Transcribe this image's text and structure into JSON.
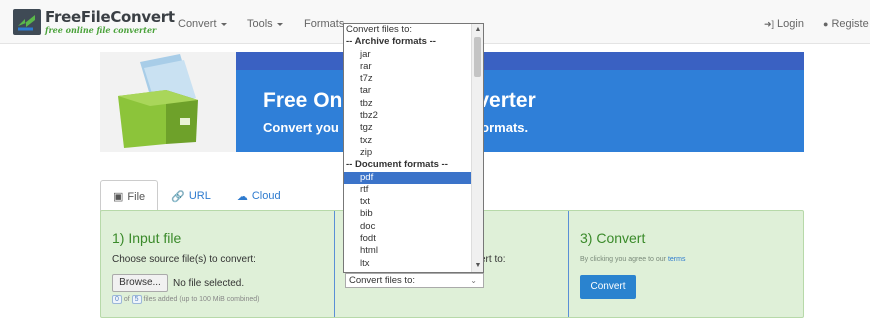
{
  "brand": {
    "name": "FreeFileConvert",
    "tagline": "free online file converter"
  },
  "nav": {
    "items": [
      {
        "label": "Convert",
        "caret": true
      },
      {
        "label": "Tools",
        "caret": true
      },
      {
        "label": "Formats",
        "caret": false
      }
    ],
    "login": "Login",
    "register": "Registe"
  },
  "banner": {
    "title_a": "Free On",
    "title_b": "verter",
    "sub_a": "Convert you",
    "sub_b": "formats."
  },
  "tabs": [
    {
      "label": "File",
      "icon": "monitor-icon",
      "active": true
    },
    {
      "label": "URL",
      "icon": "link-icon",
      "active": false
    },
    {
      "label": "Cloud",
      "icon": "cloud-icon",
      "active": false
    }
  ],
  "input_col": {
    "heading": "1) Input file",
    "label": "Choose source file(s) to convert:",
    "browse": "Browse...",
    "no_file": "No file selected.",
    "count": "0",
    "of": "of",
    "max": "5",
    "count_suffix": "files added (up to 100 MiB combined)"
  },
  "output_col": {
    "label_tail": "ert to:",
    "select_value": "Convert files to:"
  },
  "convert_col": {
    "heading": "3) Convert",
    "terms_prefix": "By clicking you agree to our ",
    "terms_link": "terms",
    "button": "Convert"
  },
  "dropdown": {
    "options": [
      {
        "label": "Convert files to:",
        "kind": "head"
      },
      {
        "label": "-- Archive formats --",
        "kind": "group"
      },
      {
        "label": "jar",
        "kind": "option"
      },
      {
        "label": "rar",
        "kind": "option"
      },
      {
        "label": "t7z",
        "kind": "option"
      },
      {
        "label": "tar",
        "kind": "option"
      },
      {
        "label": "tbz",
        "kind": "option"
      },
      {
        "label": "tbz2",
        "kind": "option"
      },
      {
        "label": "tgz",
        "kind": "option"
      },
      {
        "label": "txz",
        "kind": "option"
      },
      {
        "label": "zip",
        "kind": "option"
      },
      {
        "label": "-- Document formats --",
        "kind": "group"
      },
      {
        "label": "pdf",
        "kind": "option",
        "selected": true
      },
      {
        "label": "rtf",
        "kind": "option"
      },
      {
        "label": "txt",
        "kind": "option"
      },
      {
        "label": "bib",
        "kind": "option"
      },
      {
        "label": "doc",
        "kind": "option"
      },
      {
        "label": "fodt",
        "kind": "option"
      },
      {
        "label": "html",
        "kind": "option"
      },
      {
        "label": "ltx",
        "kind": "option"
      }
    ]
  },
  "colors": {
    "accent": "#2a83cf",
    "panel": "#dff0d8",
    "banner": "#2f7fd8",
    "heading_green": "#3a8a2a"
  }
}
